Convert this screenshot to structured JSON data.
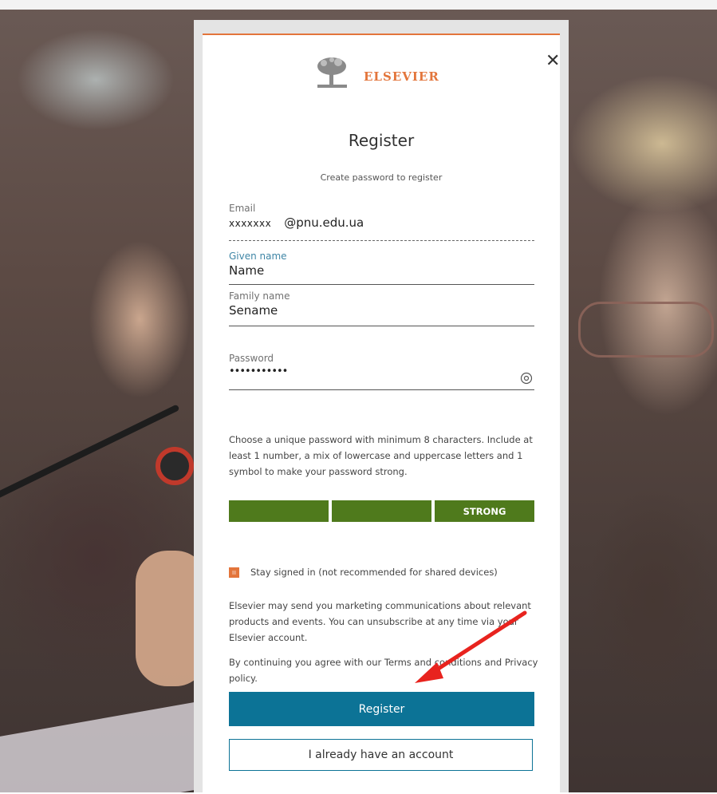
{
  "modal": {
    "brand": "ELSEVIER",
    "close_glyph": "✕",
    "title": "Register",
    "subtitle": "Create password to register",
    "email": {
      "label": "Email",
      "value_local": "xxxxxxx",
      "value_domain": "@pnu.edu.ua"
    },
    "given_name": {
      "label": "Given name",
      "value": "Name"
    },
    "family_name": {
      "label": "Family name",
      "value": "Sename"
    },
    "password": {
      "label": "Password",
      "value": "•••••••••••",
      "toggle_icon": "eye-icon"
    },
    "help_text": "Choose a unique password with minimum 8 characters. Include at least 1 number, a mix of lowercase and uppercase letters and 1 symbol to make your password strong.",
    "strength": {
      "segments": [
        "",
        "",
        "STRONG"
      ],
      "color": "#4f7a1c"
    },
    "stay_signed_in": "Stay signed in (not recommended for shared devices)",
    "marketing": "Elsevier may send you marketing communications about relevant products and events. You can unsubscribe at any time via your Elsevier account.",
    "terms": "By continuing you agree with our Terms and conditions and Privacy policy.",
    "register_button": "Register",
    "existing_account_button": "I already have an account"
  },
  "colors": {
    "accent": "#e3753b",
    "primary": "#0c7396",
    "annotation": "#e8231e"
  }
}
